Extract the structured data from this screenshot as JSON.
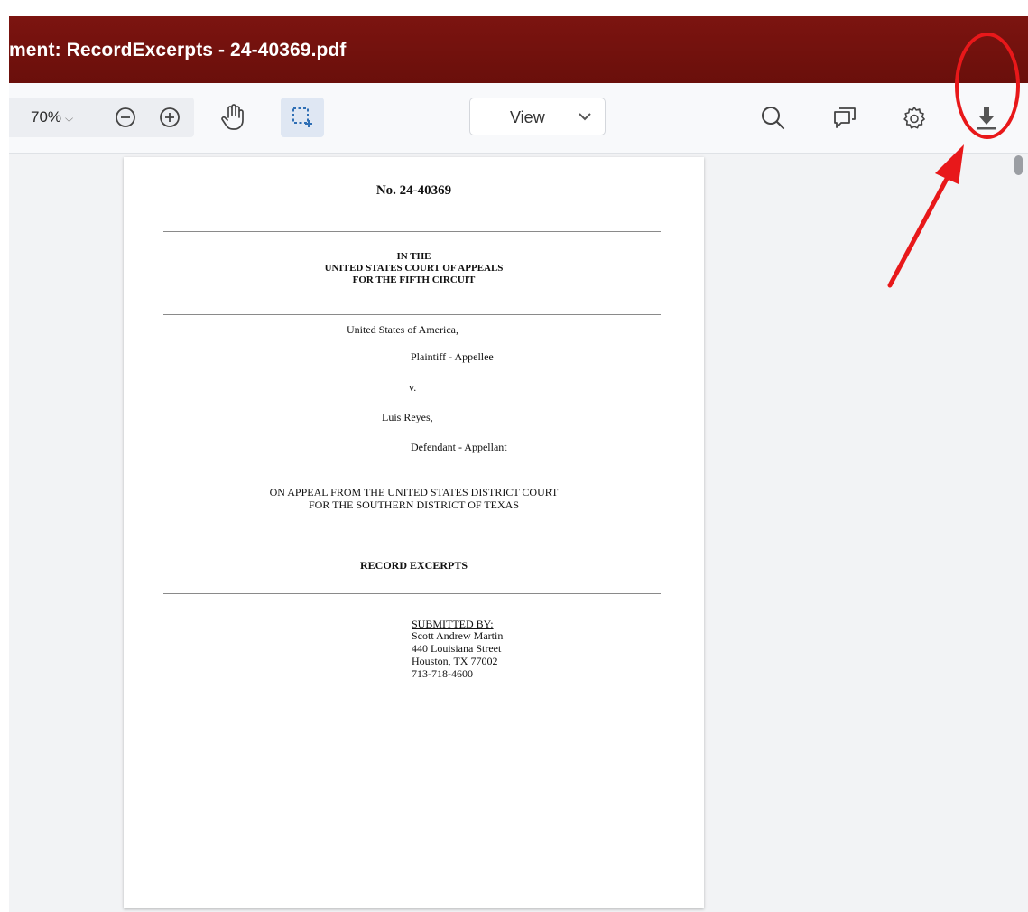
{
  "window": {
    "title": "ment: RecordExcerpts - 24-40369.pdf"
  },
  "toolbar": {
    "zoom_level": "70%",
    "zoom_chevron": "⌵",
    "view_mode": "View",
    "icons": [
      "zoom-out-icon",
      "zoom-in-icon",
      "pan-hand-icon",
      "area-select-icon",
      "search-icon",
      "comments-icon",
      "settings-gear-icon",
      "download-icon"
    ]
  },
  "document": {
    "case_number": "No. 24-40369",
    "court_line1": "IN THE",
    "court_line2": "UNITED STATES COURT OF APPEALS",
    "court_line3": "FOR THE FIFTH CIRCUIT",
    "party1": "United States of America,",
    "party1_role": "Plaintiff - Appellee",
    "versus": "v.",
    "party2": "Luis Reyes,",
    "party2_role": "Defendant - Appellant",
    "appeal_line1": "ON APPEAL FROM THE UNITED STATES DISTRICT COURT",
    "appeal_line2": "FOR THE SOUTHERN DISTRICT OF TEXAS",
    "doc_title": "RECORD EXCERPTS",
    "submitted_label": "SUBMITTED BY:",
    "submitter_name": "Scott Andrew Martin",
    "submitter_street": "440 Louisiana Street",
    "submitter_city": "Houston, TX 77002",
    "submitter_phone": "713-718-4600"
  },
  "colors": {
    "title_bar": "#7c1410",
    "annotation": "#e8181a",
    "toolbar_bg": "#f8f9fb",
    "viewport_bg": "#f2f3f5"
  }
}
